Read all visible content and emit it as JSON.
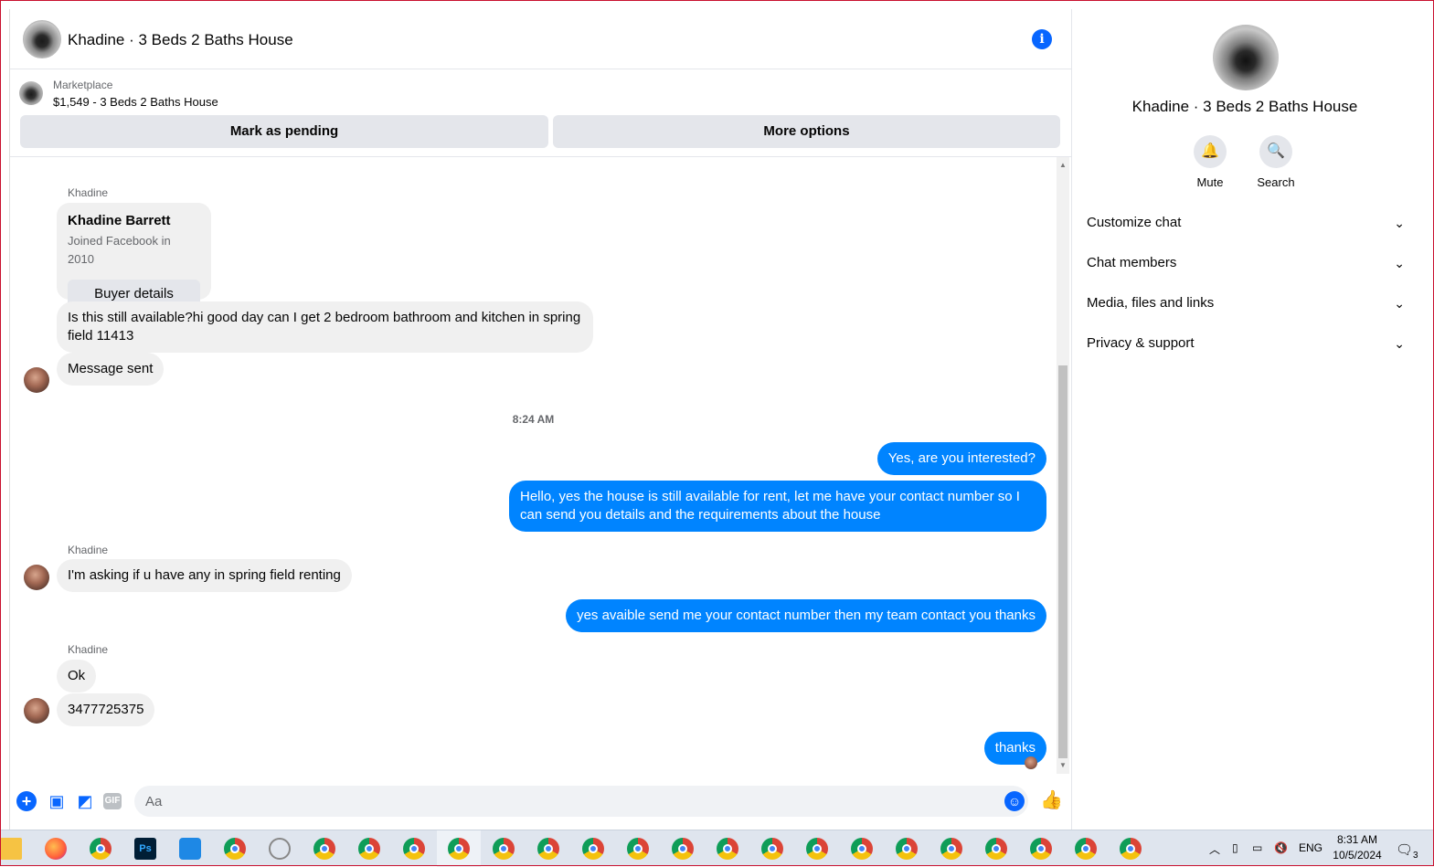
{
  "chat": {
    "title": "Khadine · 3 Beds 2 Baths House",
    "info_icon": "info-icon",
    "marketplace": {
      "label": "Marketplace",
      "listing": "$1,549 - 3 Beds 2 Baths House",
      "mark_pending": "Mark as pending",
      "more_options": "More options"
    }
  },
  "messages": {
    "sender1": "Khadine",
    "card": {
      "name": "Khadine Barrett",
      "joined": "Joined Facebook in 2010",
      "button": "Buyer details"
    },
    "msg1": "Is this still available?hi good day can I get 2 bedroom bathroom and kitchen in spring field  11413",
    "msg2": "Message sent",
    "time": "8:24 AM",
    "out1": "Yes, are you interested?",
    "out2": "Hello, yes the house is still available for rent, let me have your contact number so I can send you details and the requirements about the house",
    "sender2": "Khadine",
    "msg3": "I'm asking if u have any in spring field renting",
    "out3": "yes avaible send me your contact number then my team contact you thanks",
    "sender3": "Khadine",
    "msg4": "Ok",
    "msg5": "3477725375",
    "out4": "thanks"
  },
  "composer": {
    "placeholder": "Aa"
  },
  "panel": {
    "title": "Khadine · 3 Beds 2 Baths House",
    "actions": {
      "mute": "Mute",
      "search": "Search"
    },
    "sections": [
      "Customize chat",
      "Chat members",
      "Media, files and links",
      "Privacy & support"
    ]
  },
  "taskbar": {
    "lang": "ENG",
    "time": "8:31 AM",
    "date": "10/5/2024",
    "notif_count": "3"
  },
  "colors": {
    "accent": "#0866ff",
    "outgoing": "#0084ff",
    "incoming": "#f0f0f0"
  }
}
